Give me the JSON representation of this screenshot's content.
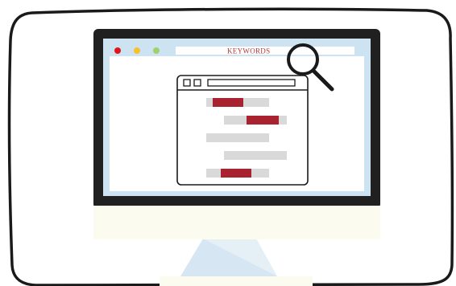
{
  "search_bar": {
    "keyword_label": "KEYWORDS"
  },
  "window_controls": {
    "close_color": "#e0141e",
    "minimize_color": "#f6c12b",
    "maximize_color": "#9fd16a"
  },
  "colors": {
    "bezel": "#202020",
    "screen_bg": "#cde3f1",
    "screen_inner": "#ffffff",
    "stand": "#d6e6f2",
    "chin": "#fbfbf0",
    "highlight": "#a8232f",
    "placeholder_bar": "#d9d9d9",
    "keyword_text": "#b23a3a"
  },
  "result_rows": [
    {
      "highlighted": true
    },
    {
      "highlighted": true
    },
    {
      "highlighted": false
    },
    {
      "highlighted": false
    },
    {
      "highlighted": true
    }
  ],
  "icons": {
    "magnifier": "magnifying-glass-icon"
  }
}
